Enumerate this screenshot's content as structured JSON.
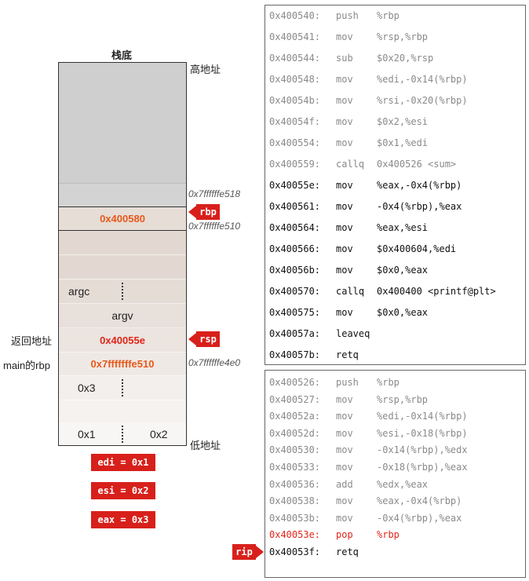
{
  "stack": {
    "top_title": "栈底",
    "high_label": "高地址",
    "low_label": "低地址",
    "addresses": {
      "a518": "0x7ffffffe518",
      "a510": "0x7ffffffe510",
      "a4e0": "0x7ffffffe4e0"
    },
    "cells": {
      "saved_rbp": "0x400580",
      "argc": "argc",
      "argv": "argv",
      "return_addr": "0x40055e",
      "main_rbp_val": "0x7fffffffe510",
      "x3": "0x3",
      "x1": "0x1",
      "x2": "0x2"
    },
    "left_labels": {
      "return_addr": "返回地址",
      "main_rbp": "main的rbp"
    },
    "pointers": {
      "rbp": "rbp",
      "rsp": "rsp",
      "rip": "rip"
    },
    "registers": [
      "edi = 0x1",
      "esi = 0x2",
      "eax = 0x3"
    ]
  },
  "code_main": [
    {
      "addr": "0x400540:",
      "op": "push",
      "args": "%rbp",
      "style": "gray"
    },
    {
      "addr": "0x400541:",
      "op": "mov",
      "args": "%rsp,%rbp",
      "style": "gray"
    },
    {
      "addr": "0x400544:",
      "op": "sub",
      "args": "$0x20,%rsp",
      "style": "gray"
    },
    {
      "addr": "0x400548:",
      "op": "mov",
      "args": "%edi,-0x14(%rbp)",
      "style": "gray"
    },
    {
      "addr": "0x40054b:",
      "op": "mov",
      "args": "%rsi,-0x20(%rbp)",
      "style": "gray"
    },
    {
      "addr": "0x40054f:",
      "op": "mov",
      "args": "$0x2,%esi",
      "style": "gray"
    },
    {
      "addr": "0x400554:",
      "op": "mov",
      "args": "$0x1,%edi",
      "style": "gray"
    },
    {
      "addr": "0x400559:",
      "op": "callq",
      "args": "0x400526 <sum>",
      "style": "gray"
    },
    {
      "addr": "0x40055e:",
      "op": "mov",
      "args": "%eax,-0x4(%rbp)",
      "style": "dark"
    },
    {
      "addr": "0x400561:",
      "op": "mov",
      "args": "-0x4(%rbp),%eax",
      "style": "dark"
    },
    {
      "addr": "0x400564:",
      "op": "mov",
      "args": "%eax,%esi",
      "style": "dark"
    },
    {
      "addr": "0x400566:",
      "op": "mov",
      "args": "$0x400604,%edi",
      "style": "dark"
    },
    {
      "addr": "0x40056b:",
      "op": "mov",
      "args": "$0x0,%eax",
      "style": "dark"
    },
    {
      "addr": "0x400570:",
      "op": "callq",
      "args": "0x400400 <printf@plt>",
      "style": "dark"
    },
    {
      "addr": "0x400575:",
      "op": "mov",
      "args": "$0x0,%eax",
      "style": "dark"
    },
    {
      "addr": "0x40057a:",
      "op": "leaveq",
      "args": "",
      "style": "dark"
    },
    {
      "addr": "0x40057b:",
      "op": "retq",
      "args": "",
      "style": "dark"
    }
  ],
  "code_sum": [
    {
      "addr": "0x400526:",
      "op": "push",
      "args": "%rbp",
      "style": "gray"
    },
    {
      "addr": "0x400527:",
      "op": "mov",
      "args": "%rsp,%rbp",
      "style": "gray"
    },
    {
      "addr": "0x40052a:",
      "op": "mov",
      "args": "%edi,-0x14(%rbp)",
      "style": "gray"
    },
    {
      "addr": "0x40052d:",
      "op": "mov",
      "args": "%esi,-0x18(%rbp)",
      "style": "gray"
    },
    {
      "addr": "0x400530:",
      "op": "mov",
      "args": "-0x14(%rbp),%edx",
      "style": "gray"
    },
    {
      "addr": "0x400533:",
      "op": "mov",
      "args": "-0x18(%rbp),%eax",
      "style": "gray"
    },
    {
      "addr": "0x400536:",
      "op": "add",
      "args": "%edx,%eax",
      "style": "gray"
    },
    {
      "addr": "0x400538:",
      "op": "mov",
      "args": "%eax,-0x4(%rbp)",
      "style": "gray"
    },
    {
      "addr": "0x40053b:",
      "op": "mov",
      "args": "-0x4(%rbp),%eax",
      "style": "gray"
    },
    {
      "addr": "0x40053e:",
      "op": "pop",
      "args": "%rbp",
      "style": "red"
    },
    {
      "addr": "0x40053f:",
      "op": "retq",
      "args": "",
      "style": "dark"
    }
  ]
}
